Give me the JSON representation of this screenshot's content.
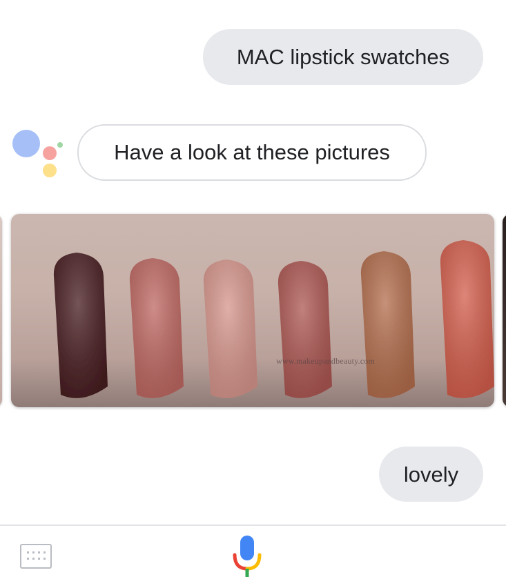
{
  "conversation": {
    "user_message_1": "MAC lipstick swatches",
    "assistant_message": "Have a look at these pictures",
    "user_message_2": "lovely"
  },
  "image_card": {
    "watermark_text": "www.makeupandbeauty.com",
    "swatch_colors": [
      "#4a1e22",
      "#c46b65",
      "#dc9a90",
      "#b25a55",
      "#b8714f",
      "#d9614f"
    ]
  },
  "bottom_bar": {
    "keyboard_icon": "keyboard-icon",
    "mic_icon": "microphone-icon"
  },
  "colors": {
    "user_bubble": "#e8e9ed",
    "assistant_border": "#dadce0",
    "mic_blue": "#4285f4",
    "mic_red": "#ea4335",
    "mic_yellow": "#fbbc05",
    "mic_green": "#34a853"
  }
}
